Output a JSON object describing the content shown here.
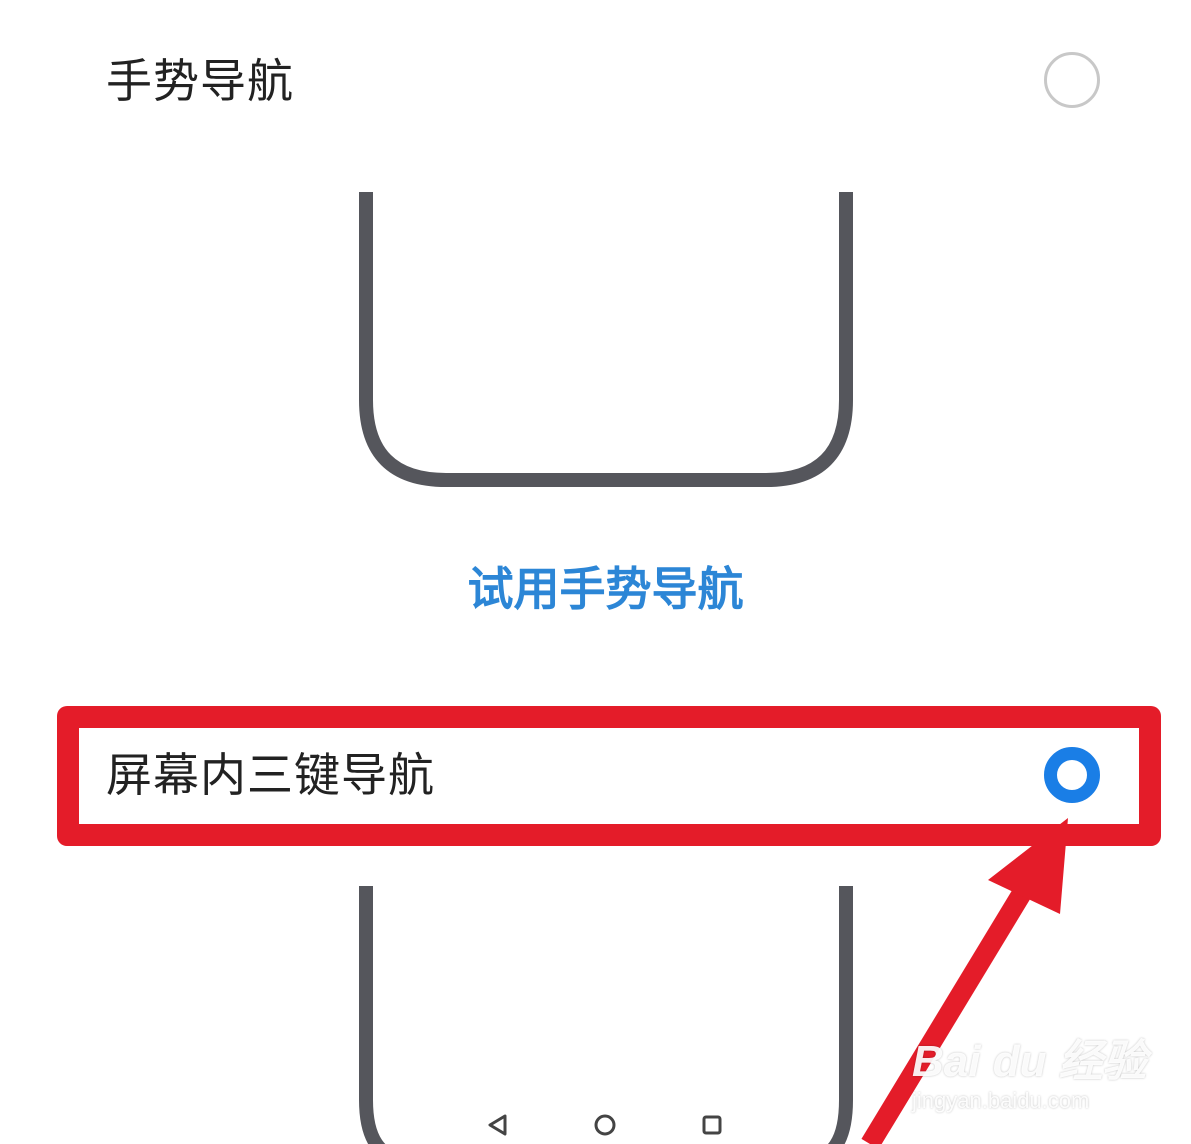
{
  "options": {
    "gesture": {
      "label": "手势导航",
      "selected": false,
      "try_link": "试用手势导航"
    },
    "three_key": {
      "label": "屏幕内三键导航",
      "selected": true,
      "nav_icons": [
        "back-triangle-icon",
        "home-circle-icon",
        "recents-square-icon"
      ]
    }
  },
  "colors": {
    "accent": "#1a7ee6",
    "link": "#2c86d6",
    "annotation": "#e41c29",
    "phone_outline": "#55565c",
    "radio_unselected": "#c8c8c8"
  },
  "watermark": {
    "brand": "Bai du 经验",
    "url": "jingyan.baidu.com"
  }
}
